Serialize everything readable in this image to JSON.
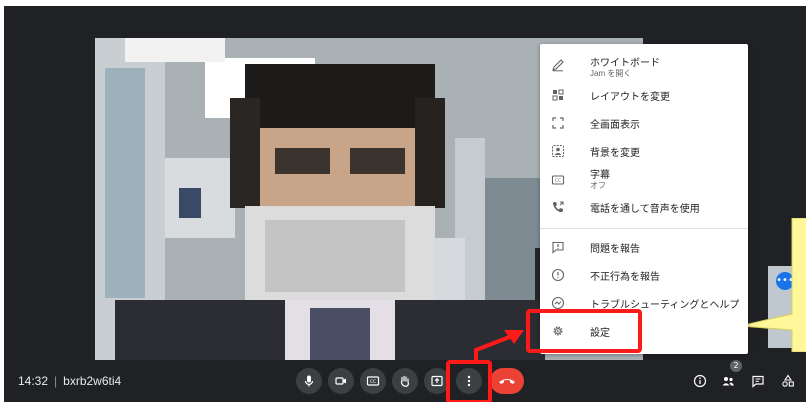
{
  "meeting": {
    "time": "14:32",
    "code": "bxrb2w6ti4"
  },
  "menu": {
    "items": [
      {
        "icon": "pencil-icon",
        "label": "ホワイトボード",
        "sub": "Jam を開く"
      },
      {
        "icon": "layout-icon",
        "label": "レイアウトを変更"
      },
      {
        "icon": "fullscreen-icon",
        "label": "全画面表示"
      },
      {
        "icon": "background-icon",
        "label": "背景を変更"
      },
      {
        "icon": "captions-icon",
        "label": "字幕",
        "sub": "オフ"
      },
      {
        "icon": "phone-audio-icon",
        "label": "電話を通して音声を使用"
      },
      {
        "icon": "report-problem-icon",
        "label": "問題を報告"
      },
      {
        "icon": "report-abuse-icon",
        "label": "不正行為を報告"
      },
      {
        "icon": "help-icon",
        "label": "トラブルシューティングとヘルプ"
      },
      {
        "icon": "gear-icon",
        "label": "設定"
      }
    ]
  },
  "controls": [
    "mic-icon",
    "camera-icon",
    "captions-icon",
    "hand-icon",
    "present-icon",
    "more-options-icon",
    "end-call-icon"
  ],
  "right_controls": {
    "participant_count": "2"
  },
  "colors": {
    "bar": "#202124",
    "end_call": "#ea4335",
    "highlight": "#ff1a1a",
    "callout": "#fff79a"
  }
}
